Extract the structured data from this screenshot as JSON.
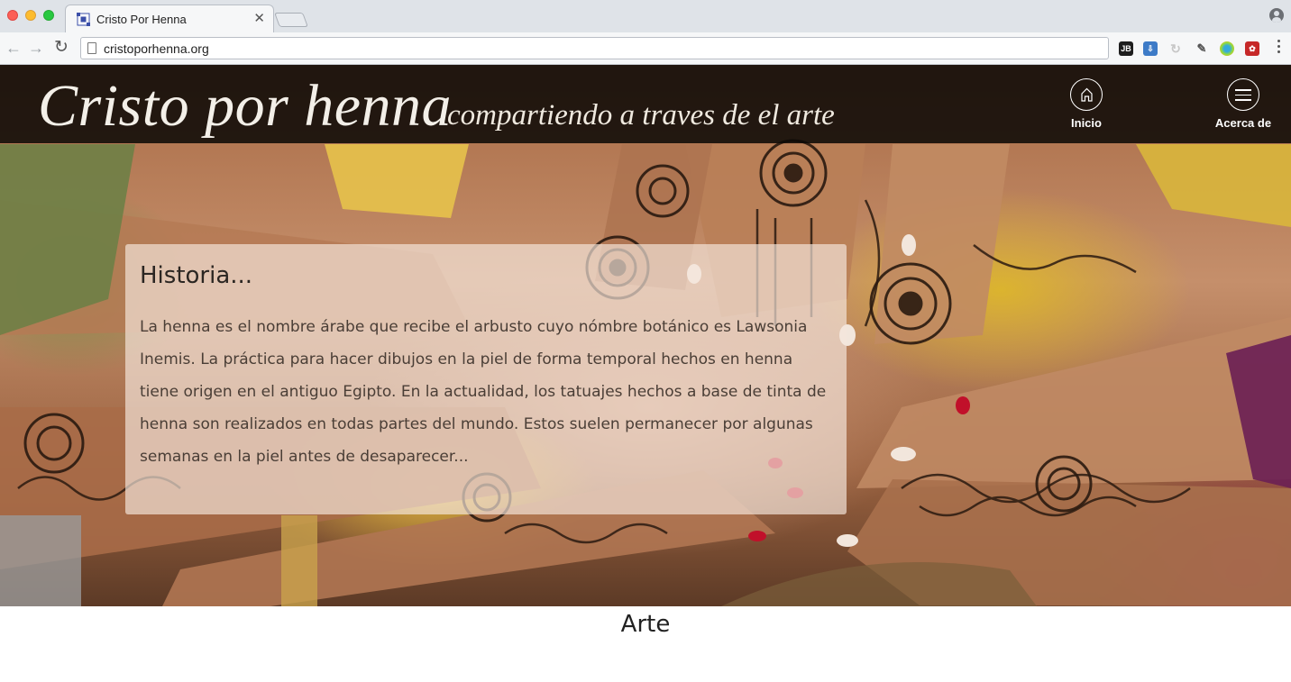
{
  "browser": {
    "tab_title": "Cristo Por Henna",
    "url": "cristoporhenna.org",
    "extensions": [
      "jetbrains-icon",
      "download-icon",
      "sync-icon",
      "eyedropper-icon",
      "color-wheel-icon",
      "puzzle-icon"
    ]
  },
  "header": {
    "brand": "Cristo por henna",
    "tagline": "compartiendo a traves de el arte",
    "nav": [
      {
        "label": "Inicio",
        "icon": "home-icon"
      },
      {
        "label": "Acerca de",
        "icon": "menu-icon"
      }
    ]
  },
  "card": {
    "title": "Historia...",
    "body": "La henna es el nombre árabe que recibe el arbusto cuyo nómbre botánico es Lawsonia Inemis. La práctica para hacer dibujos en la piel de forma temporal hechos en henna tiene origen en el antiguo Egipto. En la actualidad, los tatuajes hechos a base de tinta de henna son realizados en todas partes del mundo. Estos suelen permanecer por algunas semanas en la piel antes de desaparecer..."
  },
  "section": {
    "title": "Arte"
  },
  "colors": {
    "header_bg": "#0a0806",
    "accent_yellow": "#dcb628",
    "henna": "#2a1a10"
  }
}
